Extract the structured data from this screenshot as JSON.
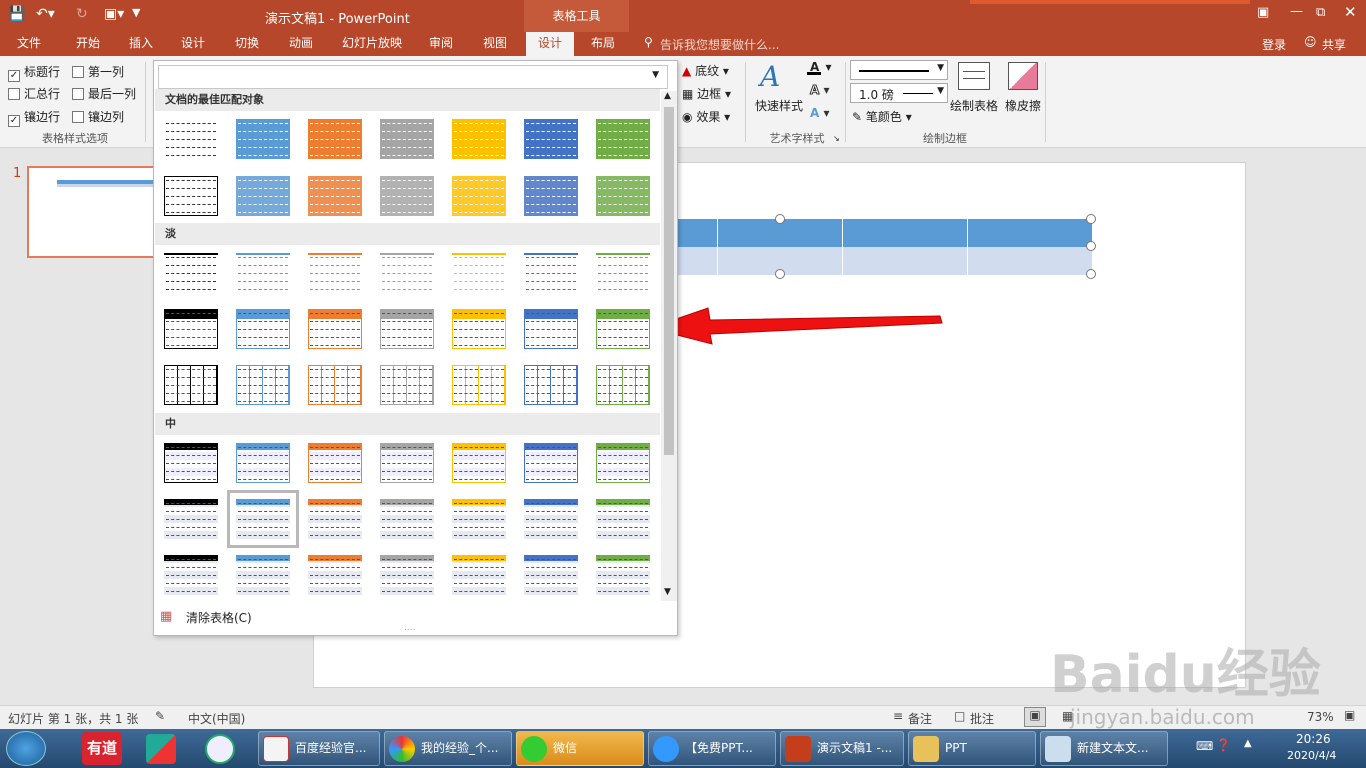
{
  "titlebar": {
    "title": "演示文稿1 - PowerPoint",
    "context_group": "表格工具",
    "save_icon": "save-icon",
    "undo_icon": "undo-icon",
    "redo_icon": "redo-icon",
    "present_icon": "presenter-icon"
  },
  "tabs": [
    "文件",
    "开始",
    "插入",
    "设计",
    "切换",
    "动画",
    "幻灯片放映",
    "审阅",
    "视图",
    "设计",
    "布局"
  ],
  "active_tab_index": 9,
  "tell_me": "告诉我您想要做什么...",
  "login": "登录",
  "share": "共享",
  "table_style_options": {
    "group_label": "表格样式选项",
    "options": [
      {
        "label": "标题行",
        "checked": true
      },
      {
        "label": "第一列",
        "checked": false
      },
      {
        "label": "汇总行",
        "checked": false
      },
      {
        "label": "最后一列",
        "checked": false
      },
      {
        "label": "镶边行",
        "checked": true
      },
      {
        "label": "镶边列",
        "checked": false
      }
    ]
  },
  "shading": {
    "shading": "底纹",
    "border": "边框",
    "effects": "效果"
  },
  "wordart": {
    "quick_styles": "快速样式",
    "group_label": "艺术字样式"
  },
  "draw_borders": {
    "pen_weight": "1.0 磅",
    "pen_color": "笔颜色",
    "draw_table": "绘制表格",
    "eraser": "橡皮擦",
    "group_label": "绘制边框"
  },
  "gallery": {
    "sections": [
      "文档的最佳匹配对象",
      "淡",
      "中"
    ],
    "clear_table": "清除表格(C)",
    "colors": [
      "#000000",
      "#5b9bd5",
      "#ed7d31",
      "#a5a5a5",
      "#ffc000",
      "#4472c4",
      "#70ad47"
    ]
  },
  "slide_thumbnail_number": "1",
  "statusbar": {
    "slide_info": "幻灯片 第 1 张，共 1 张",
    "language": "中文(中国)",
    "notes": "备注",
    "comments": "批注",
    "zoom": "73%"
  },
  "taskbar": {
    "items": [
      "有道",
      "",
      "",
      "百度经验官...",
      "我的经验_个...",
      "微信",
      "【免费PPT...",
      "演示文稿1 -...",
      "PPT",
      "新建文本文..."
    ],
    "time": "20:26",
    "date": "2020/4/4"
  },
  "watermark": "Baidu经验",
  "watermark_url": "jingyan.baidu.com"
}
